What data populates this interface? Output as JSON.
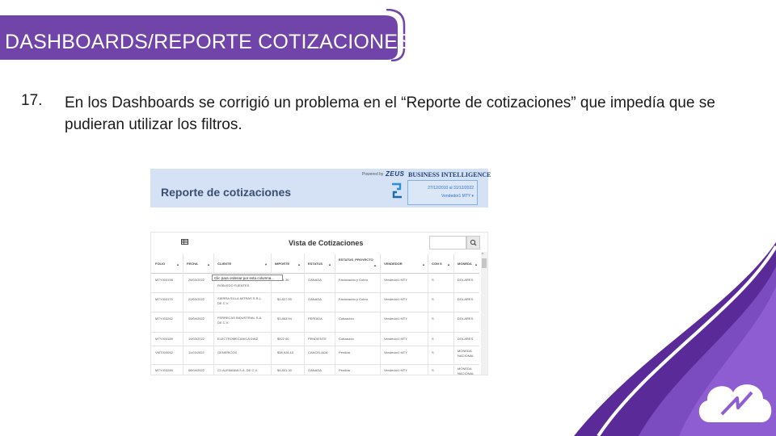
{
  "banner": {
    "title": "DASHBOARDS/REPORTE COTIZACIONES",
    "color": "#7044a8"
  },
  "item": {
    "number": "17.",
    "text": "En los Dashboards se corrigió un problema en el “Reporte de cotizaciones” que impedía que se pudieran utilizar los filtros."
  },
  "report_header": {
    "powered_by": "Powered by",
    "brand": "ZEUS",
    "product": "BUSINESS INTELLIGENCE",
    "title": "Reporte de cotizaciones",
    "filter_date": "27/12/2010 al 31/12/2022",
    "filter_vendor": "Vendedor1 MTY  ▾"
  },
  "quotes_table": {
    "title": "Vista de Cotizaciones",
    "columns": [
      "FOLIO",
      "FECHA",
      "CLIENTE",
      "IMPORTE",
      "ESTATUS",
      "ESTATUS_PROYECTO",
      "VENDEDOR",
      "CON S",
      "MONEDA"
    ],
    "tooltip": "Clic para ordenar por esta columna...",
    "rows": [
      {
        "folio": "MTY003198",
        "fecha": "28/03/2022",
        "cliente": "ROBLEDO FUENTES",
        "importe": "$371.36",
        "estatus": "GANADA",
        "proyecto": "Facturación y Cobro",
        "vendedor": "Vendedor1 MTY",
        "cons": "S",
        "moneda": "DOLARES"
      },
      {
        "folio": "MTY003170",
        "fecha": "22/03/2022",
        "cliente": "SIERRA SILLA MITRAS S.R.L. DE C.V.",
        "importe": "$1,827.00",
        "estatus": "GANADA",
        "proyecto": "Facturación y Cobro",
        "vendedor": "Vendedor1 MTY",
        "cons": "S",
        "moneda": "DOLARES"
      },
      {
        "folio": "MTY003262",
        "fecha": "05/04/2022",
        "cliente": "FERRECAS INDUSTRIAL S.A. DE C.V.",
        "importe": "$1,863.94",
        "estatus": "PERDIDA",
        "proyecto": "Cotización",
        "vendedor": "Vendedor1 MTY",
        "cons": "S",
        "moneda": "DOLARES"
      },
      {
        "folio": "MTY003189",
        "fecha": "19/03/2022",
        "cliente": "ELECTROMECANICA DIAZ",
        "importe": "$522.00",
        "estatus": "PENDIENTE",
        "proyecto": "Cotización",
        "vendedor": "Vendedor1 MTY",
        "cons": "S",
        "moneda": "DOLARES"
      },
      {
        "folio": "VMT003052",
        "fecha": "11/03/2022",
        "cliente": "GENERICOS",
        "importe": "$38,528.10",
        "estatus": "CANCELADA",
        "proyecto": "Perdida",
        "vendedor": "Vendedor1 MTY",
        "cons": "S",
        "moneda": "MONEDA NACIONAL"
      },
      {
        "folio": "MTY003289",
        "fecha": "08/04/2022",
        "cliente": "C1 ALEMANIA S.A. DE C.V.",
        "importe": "$4,801.30",
        "estatus": "GANADA",
        "proyecto": "Perdida",
        "vendedor": "Vendedor1 MTY",
        "cons": "S",
        "moneda": "MONEDA NACIONAL"
      }
    ]
  }
}
